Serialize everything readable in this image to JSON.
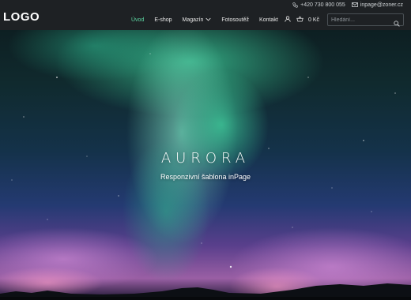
{
  "header": {
    "logo": "LOGO",
    "topbar": {
      "phone": "+420 730 800 055",
      "email": "inpage@zoner.cz",
      "phone_icon": "phone-icon",
      "email_icon": "envelope-icon"
    },
    "nav": [
      {
        "label": "Úvod",
        "active": true
      },
      {
        "label": "E-shop"
      },
      {
        "label": "Magazín",
        "has_dropdown": true
      },
      {
        "label": "Fotosoutěž"
      },
      {
        "label": "Kontakt"
      }
    ],
    "cart_total": "0 Kč",
    "search": {
      "placeholder": "Hledání..."
    },
    "accent_color": "#5ed8a4"
  },
  "hero": {
    "title": "AURORA",
    "subtitle": "Responzivní šablona inPage"
  }
}
